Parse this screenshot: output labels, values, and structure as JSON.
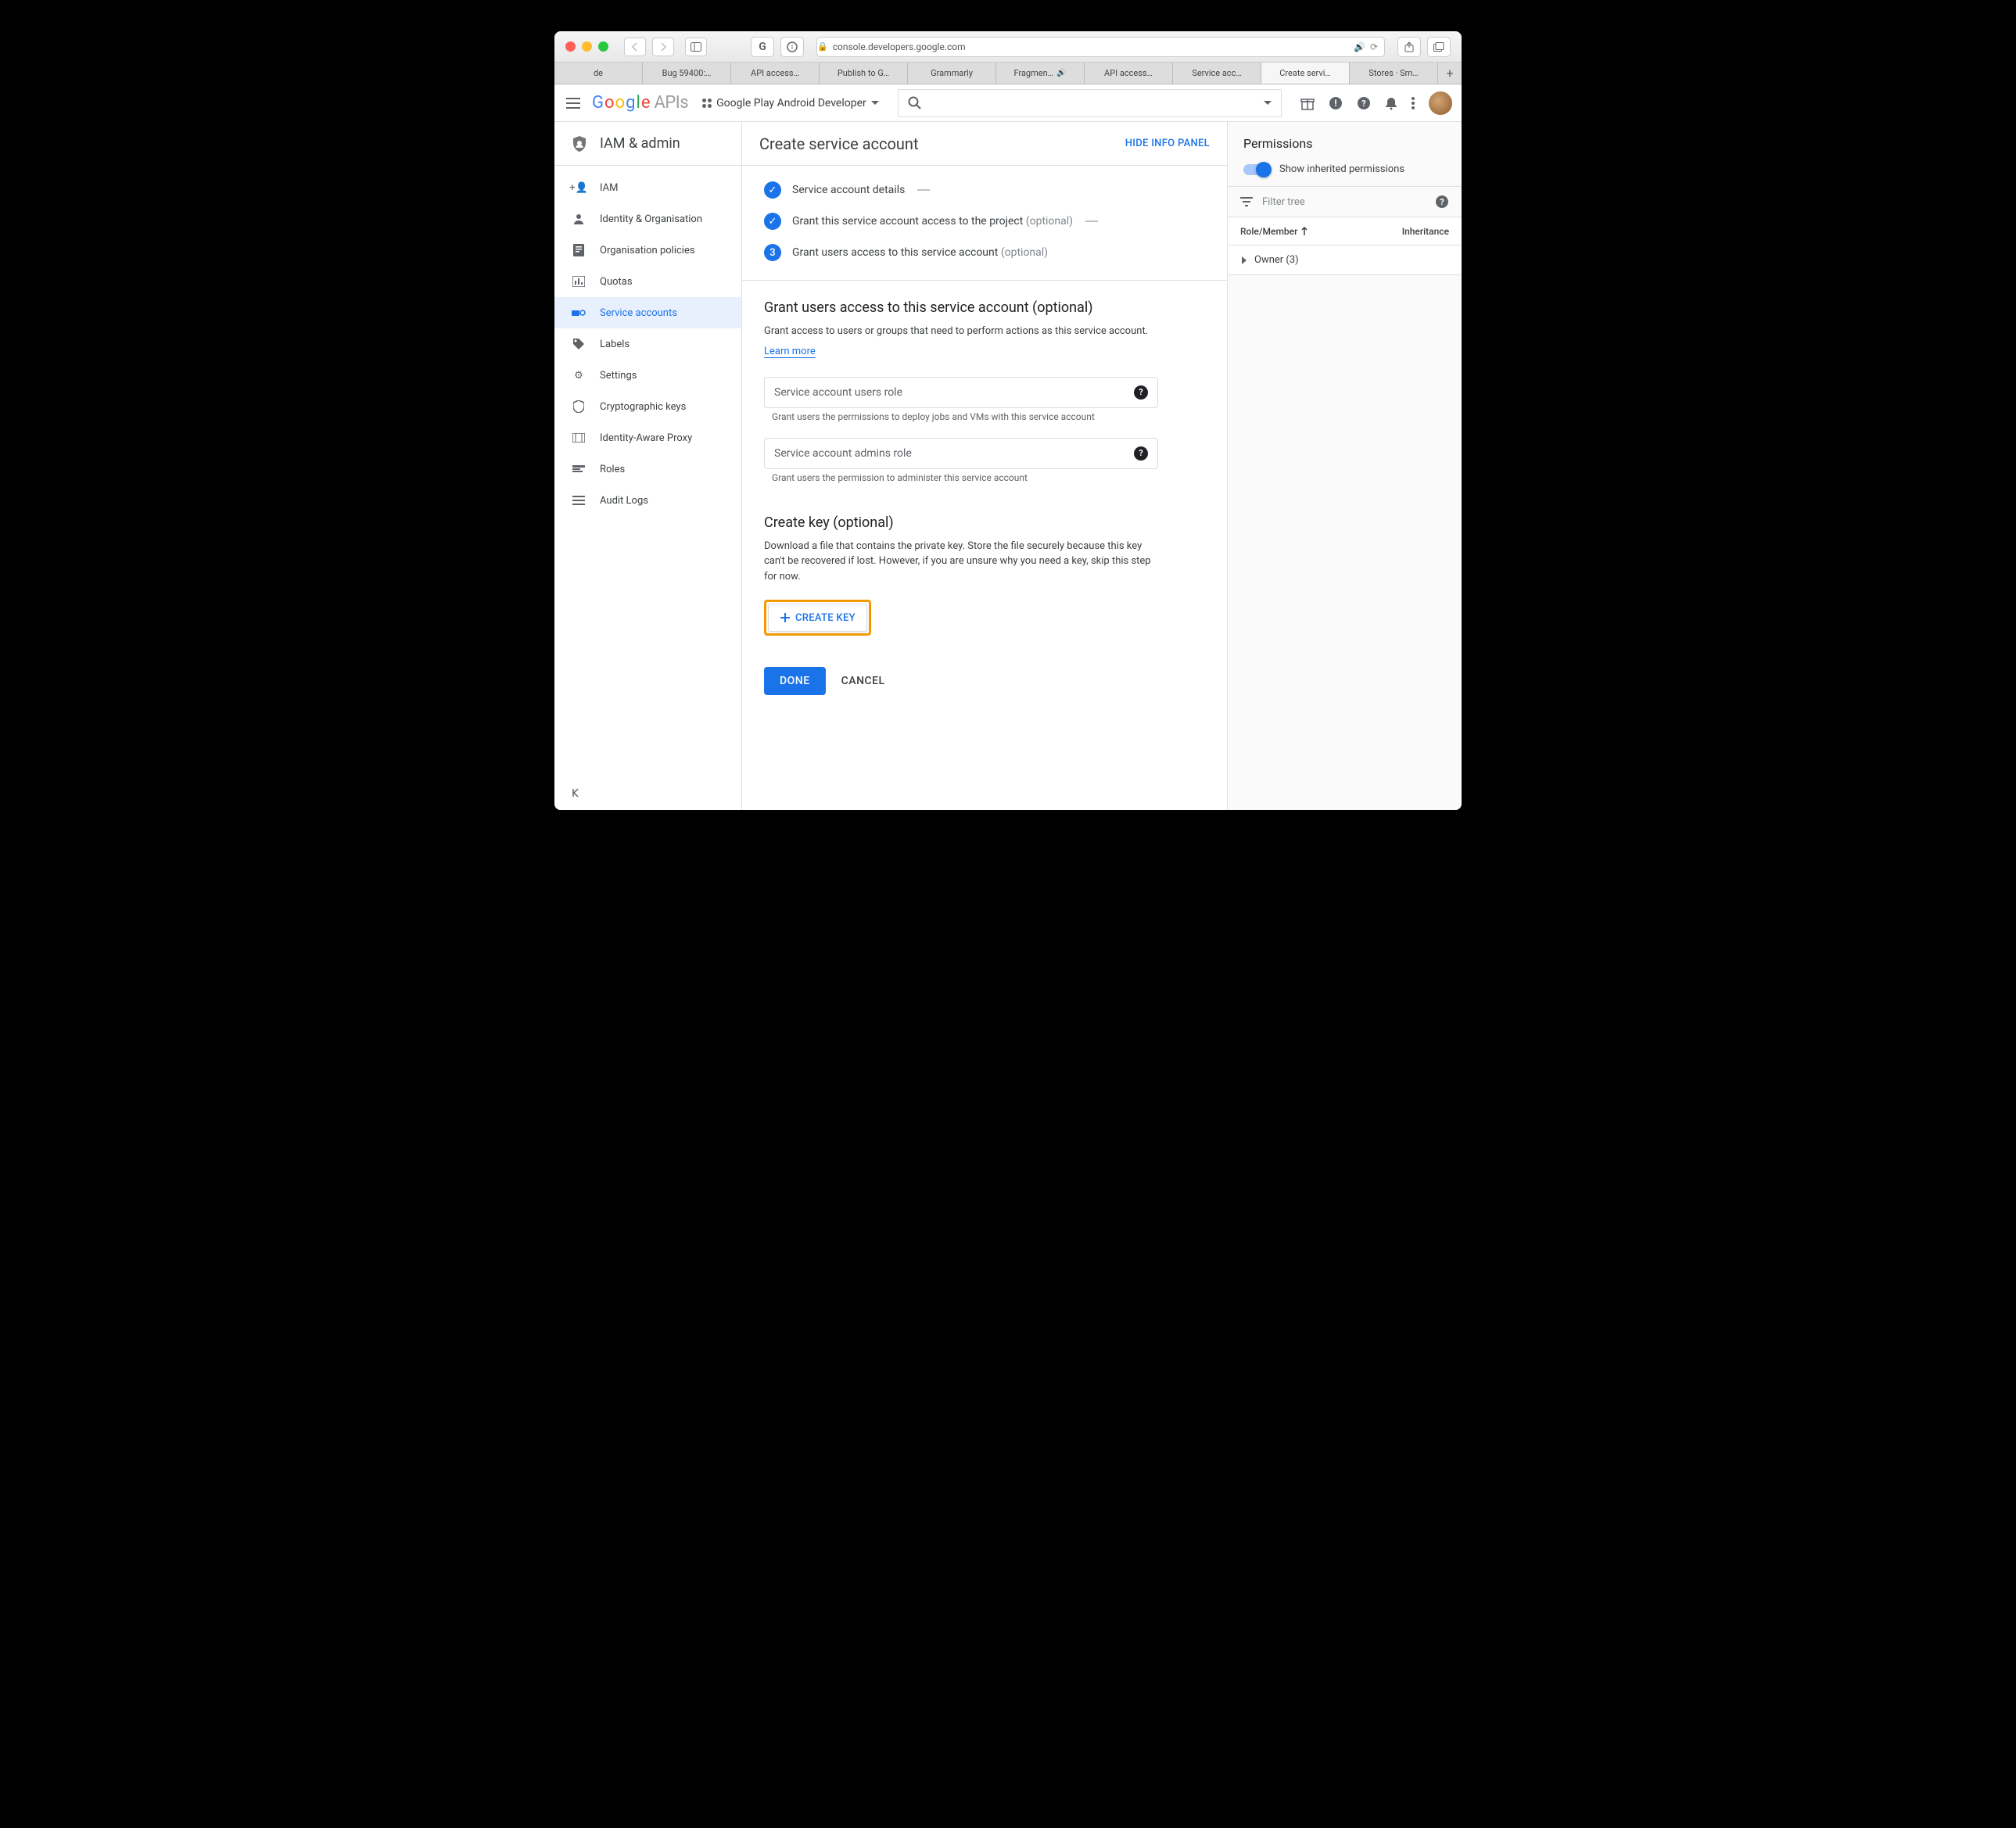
{
  "browser": {
    "url": "console.developers.google.com",
    "tabs": [
      "de",
      "Bug 59400:…",
      "API access…",
      "Publish to G…",
      "Grammarly",
      "Fragmen…",
      "API access…",
      "Service acc…",
      "Create servi…",
      "Stores · Sm…"
    ],
    "activeTab": 8
  },
  "header": {
    "logo": {
      "text": "Google",
      "suffix": "APIs"
    },
    "project": "Google Play Android Developer"
  },
  "sidebar": {
    "title": "IAM & admin",
    "items": [
      {
        "label": "IAM"
      },
      {
        "label": "Identity & Organisation"
      },
      {
        "label": "Organisation policies"
      },
      {
        "label": "Quotas"
      },
      {
        "label": "Service accounts",
        "active": true
      },
      {
        "label": "Labels"
      },
      {
        "label": "Settings"
      },
      {
        "label": "Cryptographic keys"
      },
      {
        "label": "Identity-Aware Proxy"
      },
      {
        "label": "Roles"
      },
      {
        "label": "Audit Logs"
      }
    ]
  },
  "page": {
    "title": "Create service account",
    "hidePanel": "HIDE INFO PANEL",
    "steps": [
      {
        "label": "Service account details",
        "done": true
      },
      {
        "label": "Grant this service account access to the project",
        "optional": "(optional)",
        "done": true
      },
      {
        "num": "3",
        "label": "Grant users access to this service account",
        "optional": "(optional)"
      }
    ],
    "section1": {
      "title": "Grant users access to this service account (optional)",
      "desc": "Grant access to users or groups that need to perform actions as this service account.",
      "learnMore": "Learn more",
      "field1": {
        "placeholder": "Service account users role",
        "help": "Grant users the permissions to deploy jobs and VMs with this service account"
      },
      "field2": {
        "placeholder": "Service account admins role",
        "help": "Grant users the permission to administer this service account"
      }
    },
    "section2": {
      "title": "Create key (optional)",
      "desc": "Download a file that contains the private key. Store the file securely because this key can't be recovered if lost. However, if you are unsure why you need a key, skip this step for now.",
      "createKey": "CREATE KEY"
    },
    "actions": {
      "done": "DONE",
      "cancel": "CANCEL"
    }
  },
  "rightPanel": {
    "title": "Permissions",
    "toggleLabel": "Show inherited permissions",
    "filterPlaceholder": "Filter tree",
    "columns": {
      "role": "Role/Member",
      "inh": "Inheritance"
    },
    "row": "Owner (3)"
  }
}
